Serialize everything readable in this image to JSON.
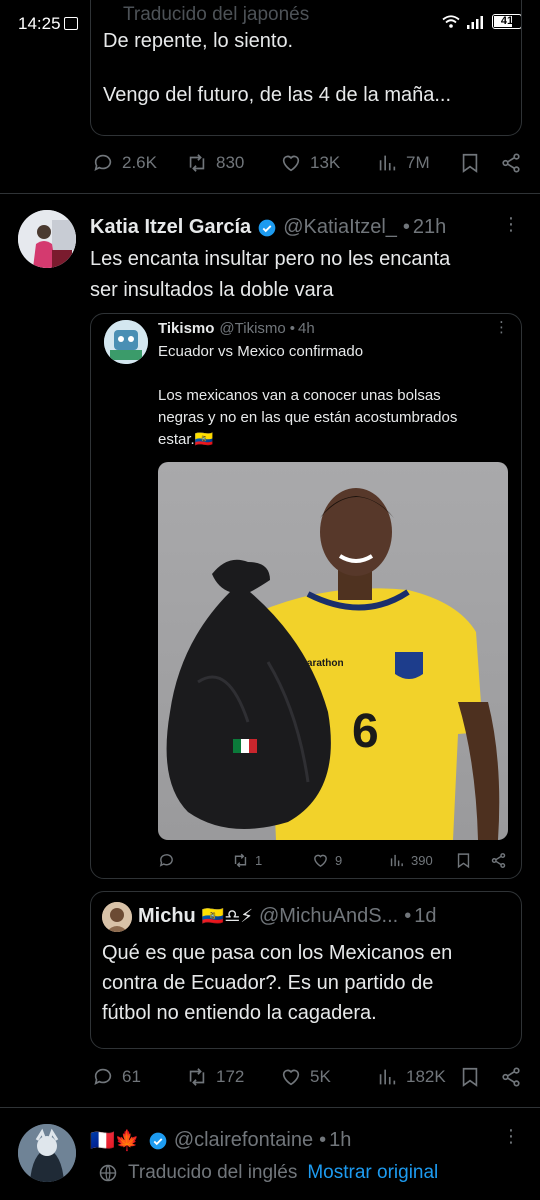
{
  "status_bar": {
    "time": "14:25",
    "battery": "41"
  },
  "prev_tweet": {
    "translate_label": "Traducido del japonés",
    "line1": "De repente, lo siento.",
    "line2": "Vengo del futuro, de las 4 de la maña...",
    "stats": {
      "replies": "2.6K",
      "retweets": "830",
      "likes": "13K",
      "views": "7M"
    }
  },
  "main_tweet": {
    "name": "Katia Itzel García",
    "handle": "@KatiaItzel_",
    "time": "21h",
    "text1": "Les encanta insultar pero no les encanta",
    "text2": "ser insultados la doble vara",
    "quoted": {
      "name": "Tikismo",
      "handle": "@Tikismo",
      "time": "4h",
      "line1": "Ecuador vs Mexico confirmado",
      "line2": "Los mexicanos van a conocer unas bolsas",
      "line3": "negras y no en las que están acostumbrados",
      "line4": "estar.🇪🇨",
      "stats": {
        "retweets": "1",
        "likes": "9",
        "views": "390"
      },
      "image": {
        "sponsor": "marathon",
        "number": "6"
      }
    }
  },
  "reply_quote": {
    "name": "Michu",
    "badges": "🇪🇨♎⚡",
    "handle": "@MichuAndS...",
    "time": "1d",
    "line1": "Qué es que pasa con los Mexicanos en",
    "line2": "contra de Ecuador?. Es un partido de",
    "line3": "fútbol no entiendo la cagadera."
  },
  "main_stats": {
    "replies": "61",
    "retweets": "172",
    "likes": "5K",
    "views": "182K"
  },
  "next_tweet": {
    "flags": "🇫🇷🍁",
    "handle": "@clairefontaine",
    "time": "1h",
    "translate_label": "Traducido del inglés",
    "show_original": "Mostrar original"
  },
  "colors": {
    "background": "#000000",
    "text": "#e7e9ea",
    "muted": "#71767b",
    "border": "#2f3336",
    "verified": "#1d9bf0",
    "link": "#1d9bf0"
  }
}
